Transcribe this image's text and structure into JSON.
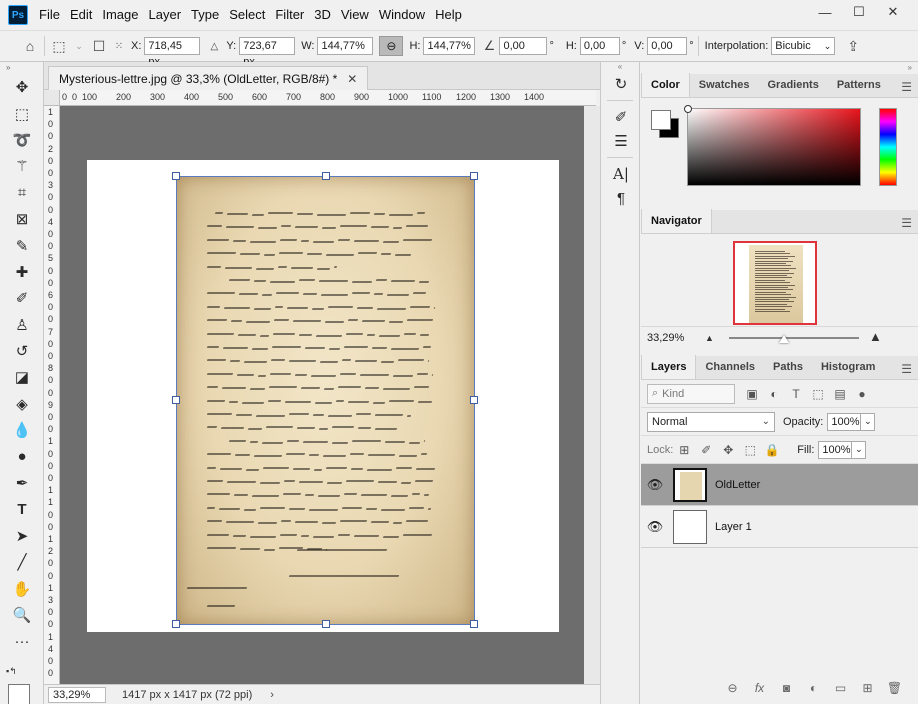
{
  "menu": {
    "items": [
      "File",
      "Edit",
      "Image",
      "Layer",
      "Type",
      "Select",
      "Filter",
      "3D",
      "View",
      "Window",
      "Help"
    ]
  },
  "window_controls": {
    "minimize": "—",
    "maximize": "☐",
    "close": "✕"
  },
  "options_bar": {
    "x_label": "X:",
    "x_value": "718,45 px",
    "y_label": "Y:",
    "y_value": "723,67 px",
    "w_label": "W:",
    "w_value": "144,77%",
    "h_label": "H:",
    "h_value": "144,77%",
    "angle_value": "0,00",
    "angle_unit": "°",
    "hskew_label": "H:",
    "hskew_value": "0,00",
    "hskew_unit": "°",
    "vskew_label": "V:",
    "vskew_value": "0,00",
    "vskew_unit": "°",
    "interp_label": "Interpolation:",
    "interp_value": "Bicubic"
  },
  "document": {
    "tab_title": "Mysterious-lettre.jpg @ 33,3% (OldLetter, RGB/8#) *",
    "zoom": "33,29%",
    "info": "1417 px x 1417 px (72 ppi)"
  },
  "rulers": {
    "h_labels": [
      "0",
      "0",
      "100",
      "200",
      "300",
      "400",
      "500",
      "600",
      "700",
      "800",
      "900",
      "1000",
      "1100",
      "1200",
      "1300",
      "1400"
    ],
    "v_labels": [
      "1",
      "0",
      "0",
      "2",
      "0",
      "0",
      "3",
      "0",
      "0",
      "4",
      "0",
      "0",
      "5",
      "0",
      "0",
      "6",
      "0",
      "0",
      "7",
      "0",
      "0",
      "8",
      "0",
      "0",
      "9",
      "0",
      "0",
      "1",
      "0",
      "0",
      "0",
      "1",
      "1",
      "0",
      "0",
      "1",
      "2",
      "0",
      "0",
      "1",
      "3",
      "0",
      "0",
      "1",
      "4",
      "0",
      "0"
    ]
  },
  "color_panel": {
    "tabs": [
      "Color",
      "Swatches",
      "Gradients",
      "Patterns"
    ],
    "active_tab": "Color",
    "foreground": "#ffffff",
    "background": "#000000",
    "hue": "#e8141c"
  },
  "navigator_panel": {
    "tab": "Navigator",
    "zoom": "33,29%",
    "view_box_color": "#e0343c"
  },
  "layers_panel": {
    "tabs": [
      "Layers",
      "Channels",
      "Paths",
      "Histogram"
    ],
    "active_tab": "Layers",
    "kind_placeholder": "Kind",
    "blend_mode": "Normal",
    "opacity_label": "Opacity:",
    "opacity_value": "100%",
    "lock_label": "Lock:",
    "fill_label": "Fill:",
    "fill_value": "100%",
    "layers": [
      {
        "name": "OldLetter",
        "selected": true
      },
      {
        "name": "Layer 1",
        "selected": false
      }
    ]
  }
}
